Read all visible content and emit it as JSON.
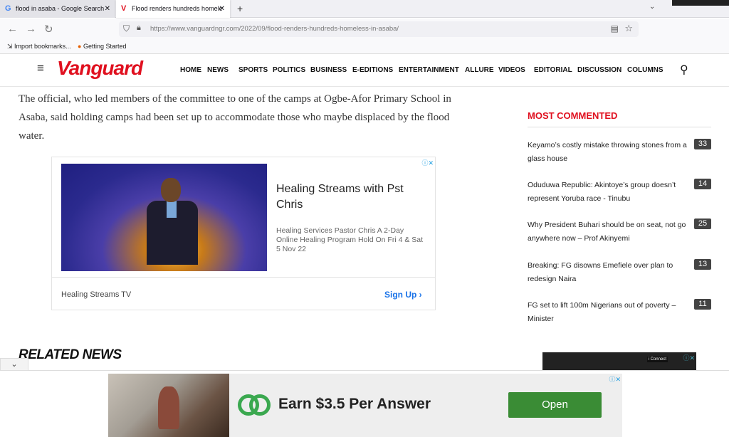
{
  "browser": {
    "tabs": [
      {
        "title": "flood in asaba - Google Search",
        "favicon": "G",
        "close": "✕"
      },
      {
        "title": "Flood renders hundreds homele",
        "favicon": "V",
        "close": "✕"
      }
    ],
    "new_tab": "+",
    "url": "https://www.vanguardngr.com/2022/09/flood-renders-hundreds-homeless-in-asaba/",
    "bookmarks": [
      {
        "label": "Import bookmarks..."
      },
      {
        "label": "Getting Started"
      }
    ]
  },
  "site": {
    "logo": "Vanguard",
    "nav": [
      "HOME",
      "NEWS",
      "SPORTS",
      "POLITICS",
      "BUSINESS",
      "E-EDITIONS",
      "ENTERTAINMENT",
      "ALLURE",
      "VIDEOS",
      "EDITORIAL",
      "DISCUSSION",
      "COLUMNS"
    ],
    "brand_color": "#e0101f"
  },
  "article": {
    "paragraph": "The official, who led members of the committee to one of the camps at Ogbe-Afor Primary School in Asaba, said holding camps had been set up to accommodate those who maybe displaced by the flood water."
  },
  "ad_main": {
    "title": "Healing Streams with Pst Chris",
    "description": "Healing Services Pastor Chris A 2-Day Online Healing Program Hold On Fri 4 & Sat 5 Nov 22",
    "brand": "Healing Streams TV",
    "cta": "Sign Up"
  },
  "related": {
    "title": "RELATED NEWS"
  },
  "sidebar": {
    "title": "MOST COMMENTED",
    "items": [
      {
        "text": "Keyamo’s costly mistake throwing stones from a glass house",
        "count": "33"
      },
      {
        "text": "Oduduwa Republic: Akintoye’s group doesn’t represent Yoruba race - Tinubu",
        "count": "14"
      },
      {
        "text": "Why President Buhari should be on seat, not go anywhere now – Prof Akinyemi",
        "count": "25"
      },
      {
        "text": "Breaking: FG disowns Emefiele over plan to redesign Naira",
        "count": "13"
      },
      {
        "text": "FG set to lift 100m Nigerians out of poverty – Minister",
        "count": "11"
      }
    ]
  },
  "ad_small": {
    "tag": "i Connect"
  },
  "ad_bottom": {
    "headline": "Earn $3.5 Per Answer",
    "cta": "Open",
    "accent": "#3a8c35"
  }
}
